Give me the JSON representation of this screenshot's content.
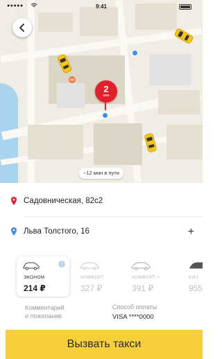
{
  "status_bar": {
    "signal": "●●●●● ",
    "wifi_icon": "wifi-icon",
    "time": "9:41"
  },
  "map": {
    "back_icon": "chevron-left-icon",
    "pickup_pin": {
      "minutes": "2",
      "unit": "мин"
    },
    "eta": "~12 мин в пути"
  },
  "route": {
    "from": "Садовническая, 82с2",
    "to": "Льва Толстого, 16",
    "add_stop": "+"
  },
  "tariffs": [
    {
      "name": "ЭКОНОМ",
      "price": "214 ₽",
      "selected": true
    },
    {
      "name": "КОМФОРТ",
      "price": "327 ₽",
      "selected": false
    },
    {
      "name": "КОМФОРТ +",
      "price": "391 ₽",
      "selected": false
    },
    {
      "name": "БИЗ",
      "price": "955",
      "selected": false
    }
  ],
  "tariff_info": "i",
  "options": {
    "comment_line1": "Комментарий",
    "comment_line2": "и пожелание",
    "payment_label": "Способ оплаты",
    "payment_value": "VISA ****0000"
  },
  "order_button": "Вызвать такси",
  "colors": {
    "accent_yellow": "#f6cf3b",
    "pin_red": "#e2202b",
    "pin_blue": "#3b8ee6",
    "map_bg": "#f1ede4"
  }
}
